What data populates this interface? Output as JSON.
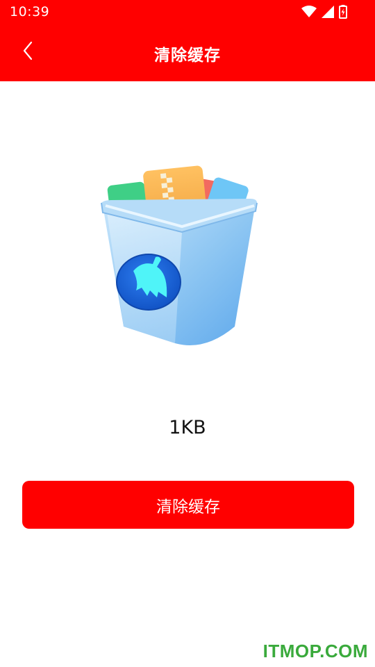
{
  "status_bar": {
    "time": "10:39",
    "icons": [
      "wifi-icon",
      "signal-icon",
      "battery-icon"
    ]
  },
  "header": {
    "title": "清除缓存",
    "back_icon": "chevron-left-icon",
    "background_color": "#ff0000"
  },
  "main": {
    "illustration": "trash-can-with-files",
    "cache_size": "1KB",
    "clear_button_label": "清除缓存",
    "button_color": "#ff0000"
  },
  "watermark": {
    "text": "ITMOP.COM",
    "color": "#3aaa3c"
  }
}
